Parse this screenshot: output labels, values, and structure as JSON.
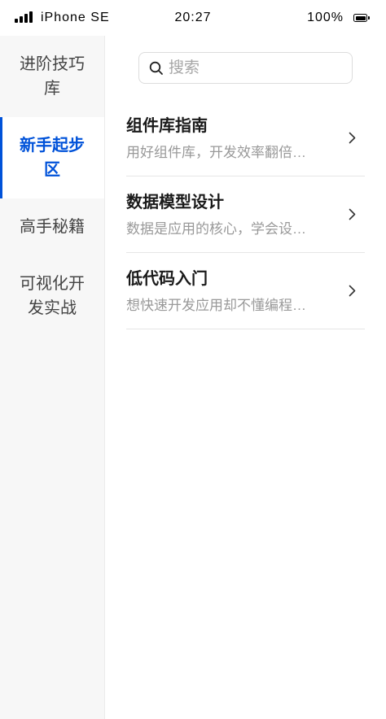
{
  "status_bar": {
    "signal_icon": "signal-icon",
    "carrier": "iPhone SE",
    "time": "20:27",
    "battery_level": "100%",
    "battery_icon": "battery-icon"
  },
  "sidebar": {
    "items": [
      {
        "label": "进阶技巧库",
        "active": false
      },
      {
        "label": "新手起步区",
        "active": true
      },
      {
        "label": "高手秘籍",
        "active": false
      },
      {
        "label": "可视化开发实战",
        "active": false
      }
    ]
  },
  "search": {
    "icon": "search-icon",
    "placeholder": "搜索",
    "value": ""
  },
  "articles": {
    "chevron_icon": "chevron-right-icon",
    "items": [
      {
        "title": "组件库指南",
        "subtitle": "用好组件库，开发效率翻倍…"
      },
      {
        "title": "数据模型设计",
        "subtitle": "数据是应用的核心，学会设…"
      },
      {
        "title": "低代码入门",
        "subtitle": "想快速开发应用却不懂编程…"
      }
    ]
  },
  "theme": {
    "accent": "#0052d9",
    "sidebar_background": "#f7f7f7",
    "text_primary": "#1a1a1a",
    "text_secondary": "#999999"
  }
}
